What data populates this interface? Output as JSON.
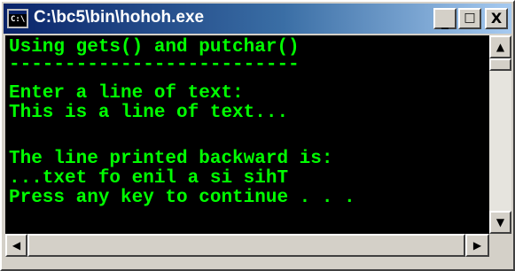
{
  "window": {
    "title": "C:\\bc5\\bin\\hohoh.exe",
    "icon_label": "C:\\",
    "buttons": {
      "minimize": "_",
      "maximize": "□",
      "close": "X"
    }
  },
  "console": {
    "text_color": "#00ff00",
    "background": "#000000",
    "lines": [
      "Using gets() and putchar()",
      "--------------------------",
      "Enter a line of text:",
      "This is a line of text...",
      "",
      "The line printed backward is:",
      "...txet fo enil a si sihT",
      "Press any key to continue . . ."
    ]
  },
  "scrollbars": {
    "up": "▲",
    "down": "▼",
    "left": "◀",
    "right": "▶"
  }
}
